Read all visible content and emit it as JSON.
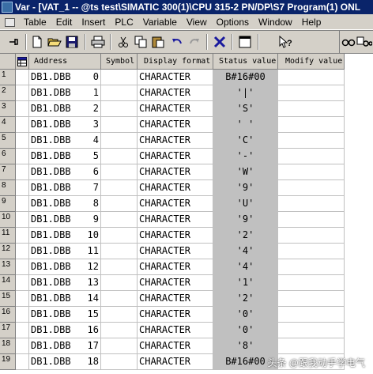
{
  "window": {
    "title": "Var - [VAT_1 -- @ts test\\SIMATIC 300(1)\\CPU 315-2 PN/DP\\S7 Program(1)  ONL"
  },
  "menu": [
    "Table",
    "Edit",
    "Insert",
    "PLC",
    "Variable",
    "View",
    "Options",
    "Window",
    "Help"
  ],
  "toolbar": {
    "icons": [
      "pin-icon",
      "new-file-icon",
      "open-folder-icon",
      "save-icon",
      "print-icon",
      "cut-icon",
      "copy-icon",
      "paste-icon",
      "undo-icon",
      "redo-icon",
      "delete-x-icon",
      "window-icon",
      "help-pointer-icon",
      "glasses-icon",
      "glasses-monitor-icon"
    ]
  },
  "table": {
    "headers": {
      "address": "Address",
      "symbol": "Symbol",
      "display_format": "Display format",
      "status_value": "Status value",
      "modify_value": "Modify value"
    },
    "rows": [
      {
        "num": "1",
        "addr": "DB1.DBB",
        "offset": "0",
        "format": "CHARACTER",
        "status": "B#16#00"
      },
      {
        "num": "2",
        "addr": "DB1.DBB",
        "offset": "1",
        "format": "CHARACTER",
        "status": "'|'"
      },
      {
        "num": "3",
        "addr": "DB1.DBB",
        "offset": "2",
        "format": "CHARACTER",
        "status": "'S'"
      },
      {
        "num": "4",
        "addr": "DB1.DBB",
        "offset": "3",
        "format": "CHARACTER",
        "status": "' '"
      },
      {
        "num": "5",
        "addr": "DB1.DBB",
        "offset": "4",
        "format": "CHARACTER",
        "status": "'C'"
      },
      {
        "num": "6",
        "addr": "DB1.DBB",
        "offset": "5",
        "format": "CHARACTER",
        "status": "'-'"
      },
      {
        "num": "7",
        "addr": "DB1.DBB",
        "offset": "6",
        "format": "CHARACTER",
        "status": "'W'"
      },
      {
        "num": "8",
        "addr": "DB1.DBB",
        "offset": "7",
        "format": "CHARACTER",
        "status": "'9'"
      },
      {
        "num": "9",
        "addr": "DB1.DBB",
        "offset": "8",
        "format": "CHARACTER",
        "status": "'U'"
      },
      {
        "num": "10",
        "addr": "DB1.DBB",
        "offset": "9",
        "format": "CHARACTER",
        "status": "'9'"
      },
      {
        "num": "11",
        "addr": "DB1.DBB",
        "offset": "10",
        "format": "CHARACTER",
        "status": "'2'"
      },
      {
        "num": "12",
        "addr": "DB1.DBB",
        "offset": "11",
        "format": "CHARACTER",
        "status": "'4'"
      },
      {
        "num": "13",
        "addr": "DB1.DBB",
        "offset": "12",
        "format": "CHARACTER",
        "status": "'4'"
      },
      {
        "num": "14",
        "addr": "DB1.DBB",
        "offset": "13",
        "format": "CHARACTER",
        "status": "'1'"
      },
      {
        "num": "15",
        "addr": "DB1.DBB",
        "offset": "14",
        "format": "CHARACTER",
        "status": "'2'"
      },
      {
        "num": "16",
        "addr": "DB1.DBB",
        "offset": "15",
        "format": "CHARACTER",
        "status": "'0'"
      },
      {
        "num": "17",
        "addr": "DB1.DBB",
        "offset": "16",
        "format": "CHARACTER",
        "status": "'0'"
      },
      {
        "num": "18",
        "addr": "DB1.DBB",
        "offset": "17",
        "format": "CHARACTER",
        "status": "'8'"
      },
      {
        "num": "19",
        "addr": "DB1.DBB",
        "offset": "18",
        "format": "CHARACTER",
        "status": "B#16#00"
      }
    ]
  },
  "watermark": "头条 @跟我动手学电气"
}
